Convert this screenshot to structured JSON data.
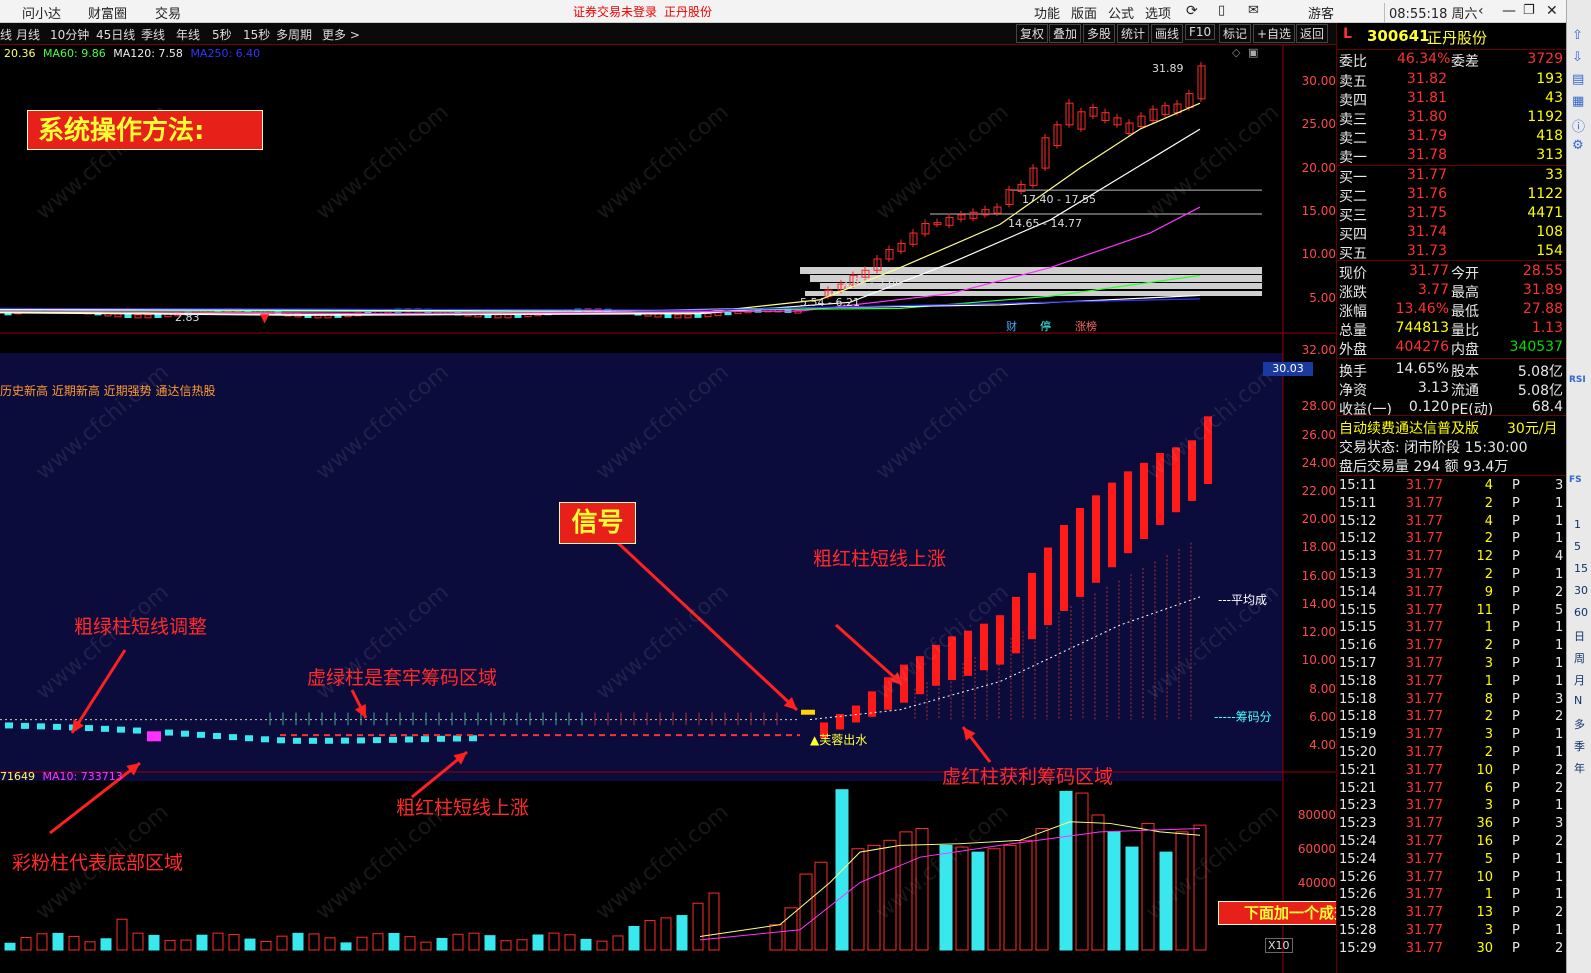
{
  "topbar": {
    "menu": [
      "问小达",
      "财富圈",
      "交易"
    ],
    "center_text": "证券交易未登录",
    "stock_name": "正丹股份",
    "right_menu": [
      "功能",
      "版面",
      "公式",
      "选项"
    ],
    "user": "游客",
    "clock": "08:55:18 周六"
  },
  "toolbar": {
    "left_items": [
      "线",
      "月线",
      "10分钟",
      "45日线",
      "季线",
      "年线",
      "5秒",
      "15秒",
      "多周期",
      "更多 >"
    ],
    "right_items": [
      "复权",
      "叠加",
      "多股",
      "统计",
      "画线",
      "F10",
      "标记",
      "+自选",
      "返回"
    ]
  },
  "ma_legend": {
    "ma_a": "20.36",
    "ma60": "MA60: 9.86",
    "ma120": "MA120: 7.58",
    "ma250": "MA250: 6.40"
  },
  "main_chart": {
    "y_ticks": [
      "30.00",
      "25.00",
      "20.00",
      "15.00",
      "10.00",
      "5.00"
    ],
    "high_label": "31.89",
    "low_label": "2.83",
    "range_labels": [
      "17.40 - 17.55",
      "14.65 - 14.77",
      "2.86 - 3.66",
      "5.54 - 6.21"
    ],
    "badges": [
      "财",
      "停",
      "涨榜"
    ]
  },
  "indicator_panel": {
    "header": "历史新高 近期新高 近期强势 通达信热股",
    "y_ticks": [
      "32.00",
      "30.00",
      "28.00",
      "26.00",
      "24.00",
      "22.00",
      "20.00",
      "18.00",
      "16.00",
      "14.00",
      "12.00",
      "10.00",
      "8.00",
      "6.00",
      "4.00"
    ],
    "current_value": "30.03",
    "avg_label": "平均成",
    "chip_label": "筹码分",
    "signal_text": "芙蓉出水"
  },
  "volume_panel": {
    "legend_a": "71649",
    "legend_ma10": "MA10: 733713",
    "y_ticks": [
      "80000",
      "60000",
      "40000"
    ],
    "unit": "X10"
  },
  "annotations": {
    "title_tag": "系统操作方法:",
    "signal_tag": "信号",
    "red_rise_1": "粗红柱短线上涨",
    "green_adjust": "粗绿柱短线调整",
    "green_dashed": "虚绿柱是套牢筹码区域",
    "red_rise_2": "粗红柱短线上涨",
    "red_dashed": "虚红柱获利筹码区域",
    "pink": "彩粉柱代表底部区域",
    "volume_tag": "下面加一个成交量指标"
  },
  "quote": {
    "code": "300641",
    "name": "正丹股份",
    "prefix": "L",
    "webi_label": "委比",
    "webi": "46.34%",
    "wecha_label": "委差",
    "wecha": "3729",
    "asks": [
      {
        "label": "卖五",
        "price": "31.82",
        "vol": "193"
      },
      {
        "label": "卖四",
        "price": "31.81",
        "vol": "43"
      },
      {
        "label": "卖三",
        "price": "31.80",
        "vol": "1192"
      },
      {
        "label": "卖二",
        "price": "31.79",
        "vol": "418"
      },
      {
        "label": "卖一",
        "price": "31.78",
        "vol": "313"
      }
    ],
    "bids": [
      {
        "label": "买一",
        "price": "31.77",
        "vol": "33"
      },
      {
        "label": "买二",
        "price": "31.76",
        "vol": "1122"
      },
      {
        "label": "买三",
        "price": "31.75",
        "vol": "4471"
      },
      {
        "label": "买四",
        "price": "31.74",
        "vol": "108"
      },
      {
        "label": "买五",
        "price": "31.73",
        "vol": "154"
      }
    ],
    "stats": [
      {
        "l1": "现价",
        "v1": "31.77",
        "l2": "今开",
        "v2": "28.55",
        "c1": "red",
        "c2": "red"
      },
      {
        "l1": "涨跌",
        "v1": "3.77",
        "l2": "最高",
        "v2": "31.89",
        "c1": "red",
        "c2": "red"
      },
      {
        "l1": "涨幅",
        "v1": "13.46%",
        "l2": "最低",
        "v2": "27.88",
        "c1": "red",
        "c2": "red"
      },
      {
        "l1": "总量",
        "v1": "744813",
        "l2": "量比",
        "v2": "1.13",
        "c1": "yel",
        "c2": "red"
      },
      {
        "l1": "外盘",
        "v1": "404276",
        "l2": "内盘",
        "v2": "340537",
        "c1": "red",
        "c2": "grn"
      },
      {
        "l1": "换手",
        "v1": "14.65%",
        "l2": "股本",
        "v2": "5.08亿",
        "c1": "wht",
        "c2": "wht"
      },
      {
        "l1": "净资",
        "v1": "3.13",
        "l2": "流通",
        "v2": "5.08亿",
        "c1": "wht",
        "c2": "wht"
      },
      {
        "l1": "收益(一)",
        "v1": "0.120",
        "l2": "PE(动)",
        "v2": "68.4",
        "c1": "wht",
        "c2": "wht"
      }
    ],
    "promo": "自动续费通达信普及版",
    "promo_price": "30元/月",
    "trade_state": "交易状态: 闭市阶段 15:30:00",
    "after_hours": "盘后交易量 294 额 93.4万"
  },
  "ticks": [
    {
      "t": "15:11",
      "p": "31.77",
      "v": "4",
      "s": "P",
      "n": "3"
    },
    {
      "t": "15:11",
      "p": "31.77",
      "v": "2",
      "s": "P",
      "n": "1"
    },
    {
      "t": "15:12",
      "p": "31.77",
      "v": "4",
      "s": "P",
      "n": "1"
    },
    {
      "t": "15:12",
      "p": "31.77",
      "v": "2",
      "s": "P",
      "n": "1"
    },
    {
      "t": "15:13",
      "p": "31.77",
      "v": "12",
      "s": "P",
      "n": "4"
    },
    {
      "t": "15:13",
      "p": "31.77",
      "v": "2",
      "s": "P",
      "n": "1"
    },
    {
      "t": "15:14",
      "p": "31.77",
      "v": "9",
      "s": "P",
      "n": "2"
    },
    {
      "t": "15:15",
      "p": "31.77",
      "v": "11",
      "s": "P",
      "n": "5"
    },
    {
      "t": "15:15",
      "p": "31.77",
      "v": "1",
      "s": "P",
      "n": "1"
    },
    {
      "t": "15:16",
      "p": "31.77",
      "v": "2",
      "s": "P",
      "n": "1"
    },
    {
      "t": "15:17",
      "p": "31.77",
      "v": "3",
      "s": "P",
      "n": "1"
    },
    {
      "t": "15:18",
      "p": "31.77",
      "v": "1",
      "s": "P",
      "n": "1"
    },
    {
      "t": "15:18",
      "p": "31.77",
      "v": "8",
      "s": "P",
      "n": "3"
    },
    {
      "t": "15:18",
      "p": "31.77",
      "v": "2",
      "s": "P",
      "n": "2"
    },
    {
      "t": "15:19",
      "p": "31.77",
      "v": "3",
      "s": "P",
      "n": "1"
    },
    {
      "t": "15:20",
      "p": "31.77",
      "v": "2",
      "s": "P",
      "n": "1"
    },
    {
      "t": "15:21",
      "p": "31.77",
      "v": "10",
      "s": "P",
      "n": "2"
    },
    {
      "t": "15:21",
      "p": "31.77",
      "v": "6",
      "s": "P",
      "n": "2"
    },
    {
      "t": "15:23",
      "p": "31.77",
      "v": "3",
      "s": "P",
      "n": "1"
    },
    {
      "t": "15:23",
      "p": "31.77",
      "v": "36",
      "s": "P",
      "n": "3"
    },
    {
      "t": "15:24",
      "p": "31.77",
      "v": "16",
      "s": "P",
      "n": "2"
    },
    {
      "t": "15:24",
      "p": "31.77",
      "v": "5",
      "s": "P",
      "n": "1"
    },
    {
      "t": "15:26",
      "p": "31.77",
      "v": "10",
      "s": "P",
      "n": "1"
    },
    {
      "t": "15:26",
      "p": "31.77",
      "v": "1",
      "s": "P",
      "n": "1"
    },
    {
      "t": "15:28",
      "p": "31.77",
      "v": "13",
      "s": "P",
      "n": "2"
    },
    {
      "t": "15:28",
      "p": "31.77",
      "v": "3",
      "s": "P",
      "n": "1"
    },
    {
      "t": "15:29",
      "p": "31.77",
      "v": "30",
      "s": "P",
      "n": "2"
    }
  ],
  "side_icons": [
    "arrow-up-icon",
    "arrow-down-icon",
    "chart-icon",
    "table-icon",
    "info-icon",
    "settings-icon"
  ],
  "period_buttons": [
    "1",
    "5",
    "15",
    "30",
    "60",
    "日",
    "周",
    "月",
    "N",
    "多",
    "季",
    "年"
  ],
  "side_text": [
    "RSI",
    "FS"
  ],
  "watermark": "www.cfchi.com",
  "colors": {
    "up": "#ff2a2a",
    "down": "#3cf0f0",
    "panel_bg": "#0a0a3a",
    "accent": "#e8201a"
  }
}
